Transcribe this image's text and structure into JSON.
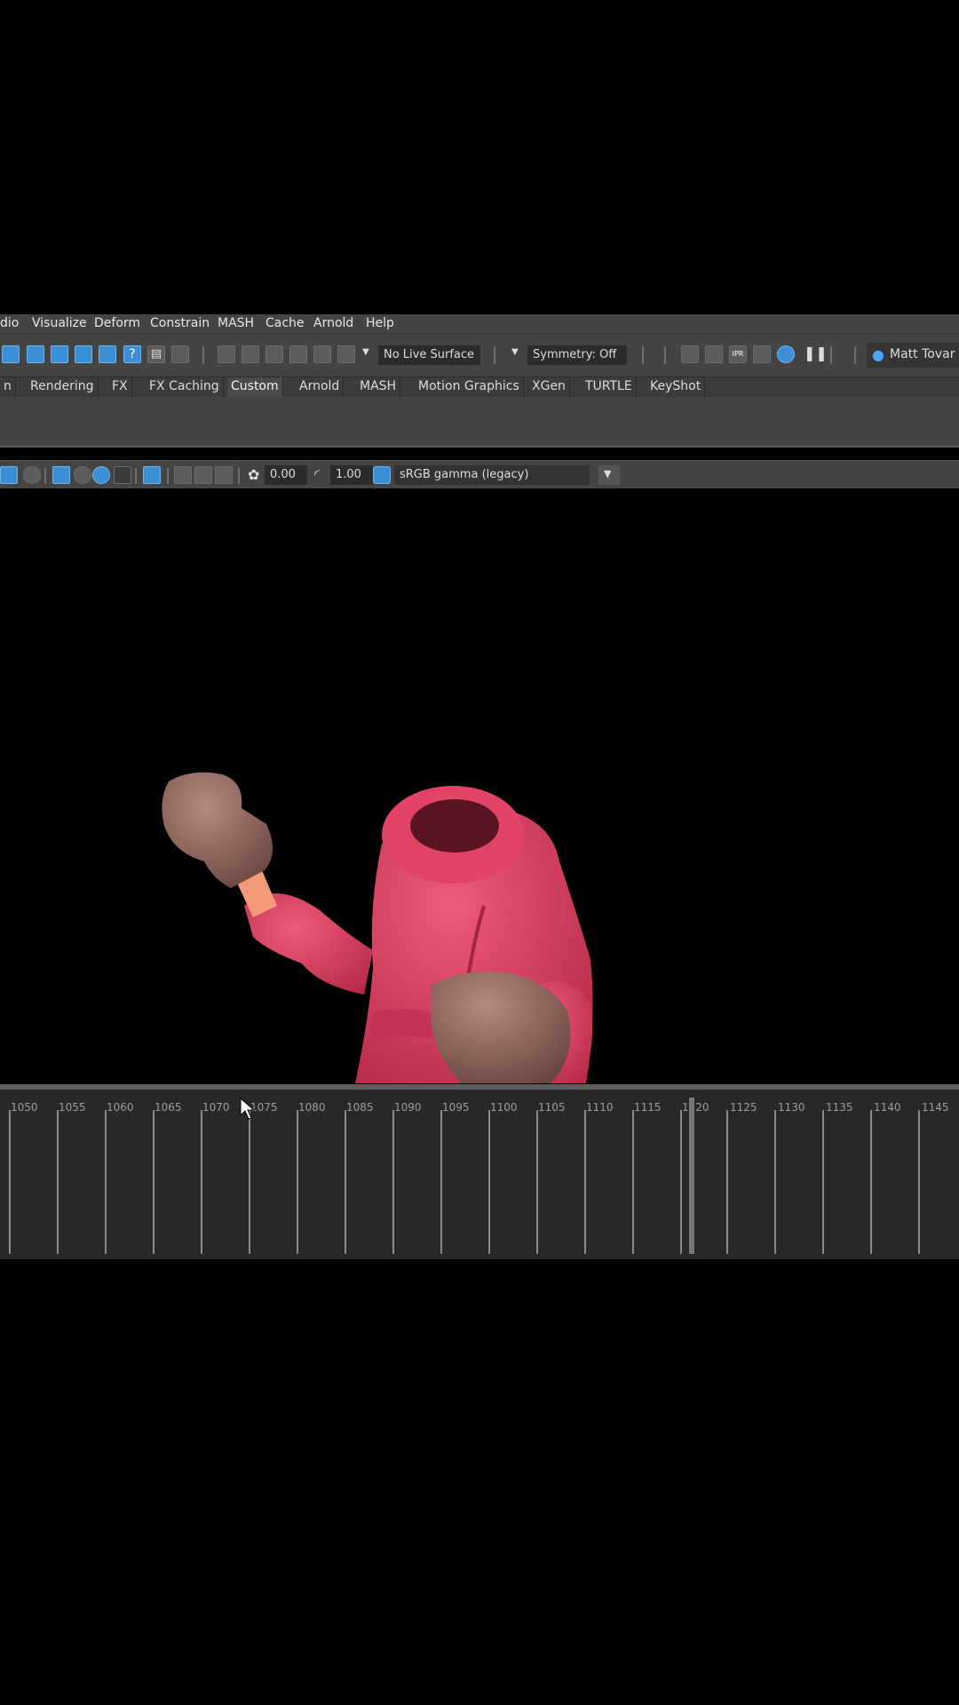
{
  "menubar": {
    "items": [
      "dio",
      "Visualize",
      "Deform",
      "Constrain",
      "MASH",
      "Cache",
      "Arnold",
      "Help"
    ]
  },
  "statusline": {
    "live_surface": "No Live Surface",
    "symmetry": "Symmetry: Off",
    "user": "Matt Tovar",
    "icons": [
      "snap-curve-icon",
      "snap-point-icon",
      "snap-grid-icon",
      "snap-view-icon",
      "snap-live-icon",
      "help-icon",
      "lock-icon",
      "select-icon",
      "lasso-icon",
      "paint-select-icon",
      "render-view-icon",
      "render-icon",
      "ipr-icon",
      "render-settings-icon",
      "hypershade-icon",
      "pause-icon",
      "user-icon"
    ]
  },
  "shelf": {
    "tabs": [
      "n",
      "Rendering",
      "FX",
      "FX Caching",
      "Custom",
      "Arnold",
      "MASH",
      "Motion Graphics",
      "XGen",
      "TURTLE",
      "KeyShot"
    ],
    "active_tab": "Custom"
  },
  "panel_toolbar": {
    "exposure": "0.00",
    "gamma": "1.00",
    "color_space": "sRGB gamma (legacy)"
  },
  "timeline": {
    "ticks": [
      "1050",
      "1055",
      "1060",
      "1065",
      "1070",
      "1075",
      "1080",
      "1085",
      "1090",
      "1095",
      "1100",
      "1105",
      "1110",
      "1115",
      "1120",
      "1125",
      "1130",
      "1135",
      "1140",
      "1145"
    ],
    "current_frame": "1120"
  }
}
